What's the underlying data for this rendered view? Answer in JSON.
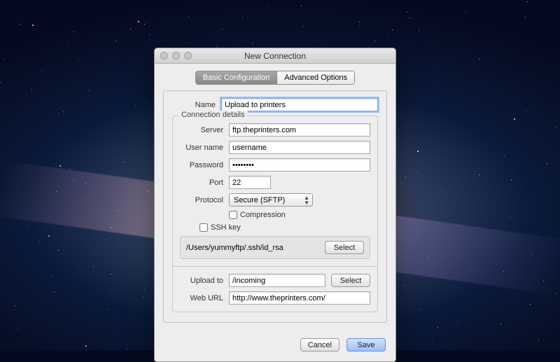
{
  "window": {
    "title": "New Connection"
  },
  "tabs": {
    "basic": "Basic Configuration",
    "advanced": "Advanced Options"
  },
  "form": {
    "name_label": "Name",
    "name_value": "Upload to printers",
    "group_title": "Connection details",
    "server_label": "Server",
    "server_value": "ftp.theprinters.com",
    "username_label": "User name",
    "username_value": "username",
    "password_label": "Password",
    "password_value": "••••••••",
    "port_label": "Port",
    "port_value": "22",
    "protocol_label": "Protocol",
    "protocol_value": "Secure (SFTP)",
    "compression_label": "Compression",
    "sshkey_label": "SSH key",
    "sshkey_path": "/Users/yummyftp/.ssh/id_rsa",
    "select_btn": "Select",
    "upload_label": "Upload to",
    "upload_value": "/incoming",
    "weburl_label": "Web URL",
    "weburl_value": "http://www.theprinters.com/"
  },
  "footer": {
    "cancel": "Cancel",
    "save": "Save"
  }
}
